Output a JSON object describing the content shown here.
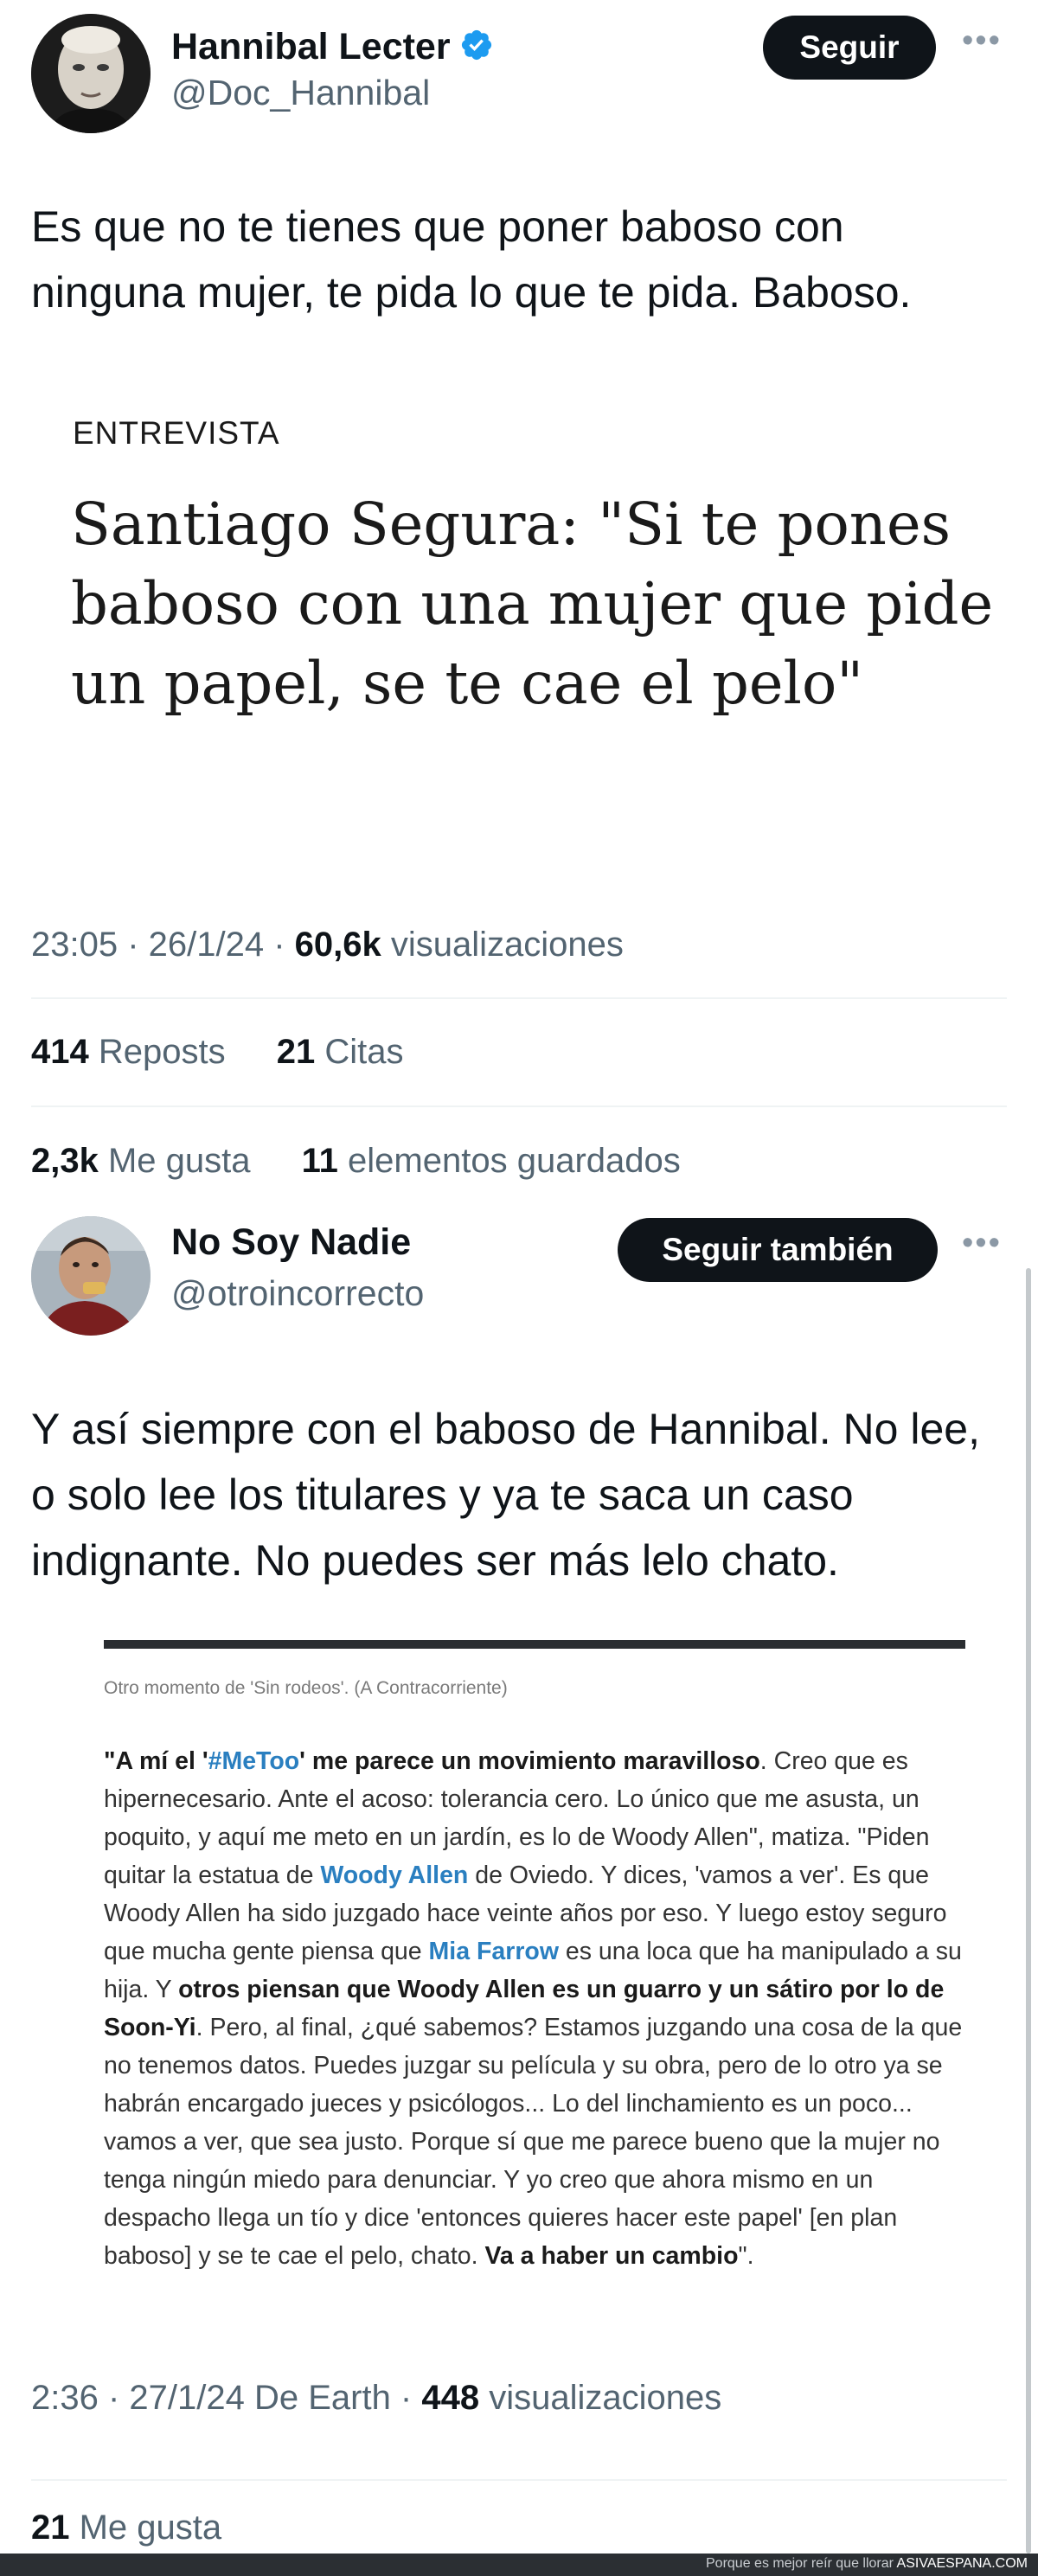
{
  "tweet1": {
    "name": "Hannibal Lecter",
    "handle": "@Doc_Hannibal",
    "follow_label": "Seguir",
    "text": "Es que no te tienes que poner baboso con ninguna mujer, te pida lo que te pida. Baboso.",
    "media": {
      "kicker": "ENTREVISTA",
      "headline": "Santiago Segura: \"Si te pones baboso con una mujer que pide un papel, se te cae el pelo\""
    },
    "time": "23:05 · 26/1/24 · ",
    "views_count": "60,6k",
    "views_label": " visualizaciones",
    "reposts_count": "414",
    "reposts_label": " Reposts",
    "quotes_count": "21",
    "quotes_label": " Citas",
    "likes_count": "2,3k",
    "likes_label": " Me gusta",
    "bookmarks_count": "11",
    "bookmarks_label": " elementos guardados"
  },
  "tweet2": {
    "name": "No Soy Nadie",
    "handle": "@otroincorrecto",
    "follow_label": "Seguir también",
    "text": "Y así siempre con el baboso de Hannibal. No lee, o solo lee los titulares y ya te saca un caso indignante. No puedes ser más lelo chato.",
    "media": {
      "caption": "Otro momento de 'Sin rodeos'. (A Contracorriente)",
      "p1": "\"A mí el '",
      "hashtag": "#MeToo",
      "p2": "' me parece un movimiento maravilloso",
      "p3": ". Creo que es hipernecesario. Ante el acoso: tolerancia cero. Lo único que me asusta, un poquito, y aquí me meto en un jardín, es lo de Woody Allen\", matiza. \"Piden quitar la estatua de ",
      "link1": "Woody Allen",
      "p4": " de Oviedo. Y dices, 'vamos a ver'. Es que Woody Allen ha sido juzgado hace veinte años por eso. Y luego estoy seguro que mucha gente piensa que ",
      "link2": "Mia Farrow",
      "p5": " es una loca que ha manipulado a su hija. Y ",
      "bold1": "otros piensan que Woody Allen es un guarro y un sátiro por lo de Soon-Yi",
      "p6": ". Pero, al final, ¿qué sabemos? Estamos juzgando una cosa de la que no tenemos datos. Puedes juzgar su película y su obra, pero de lo otro ya se habrán encargado jueces y psicólogos... Lo del linchamiento es un poco... vamos a ver, que sea justo. Porque sí que me parece bueno que la mujer no tenga ningún miedo para denunciar. Y yo creo que ahora mismo en un despacho llega un tío y dice 'entonces quieres hacer este papel' [en plan baboso] y se te cae el pelo, chato. ",
      "bold2": "Va a haber un cambio",
      "p7": "\"."
    },
    "time": "2:36 · 27/1/24 De Earth · ",
    "views_count": "448",
    "views_label": " visualizaciones",
    "likes_count": "21",
    "likes_label": " Me gusta"
  },
  "footer": {
    "tagline": "Porque es mejor reír que llorar ",
    "brand": "ASIVAESPANA.COM"
  },
  "colors": {
    "text": "#0f1419",
    "secondary": "#536471",
    "verified": "#1d9bf0",
    "button_bg": "#0f1419",
    "link": "#2a7fc0"
  },
  "icons": {
    "verified": "verified-badge-icon",
    "more": "more-options-icon"
  }
}
